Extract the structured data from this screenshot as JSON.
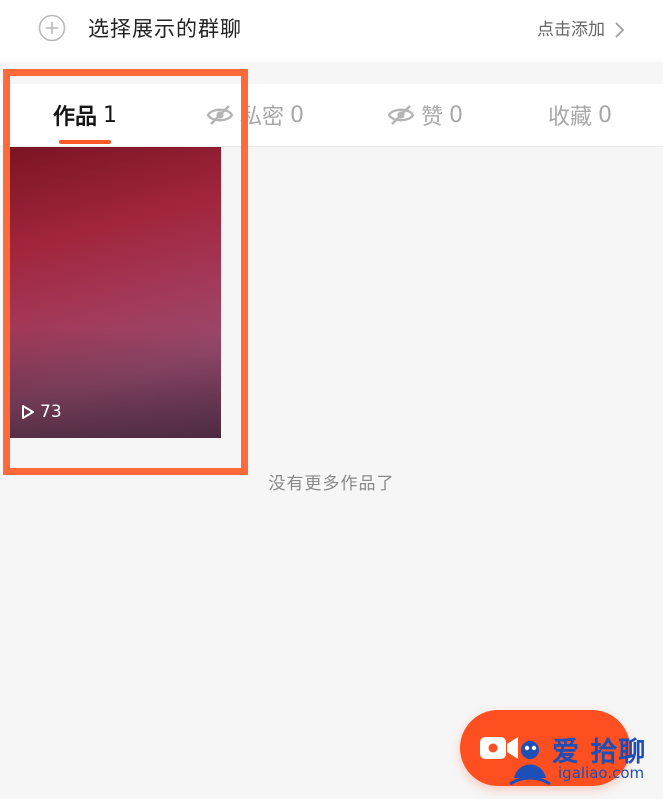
{
  "group_bar": {
    "title": "选择展示的群聊",
    "add_label": "点击添加"
  },
  "tabs": [
    {
      "label": "作品",
      "count": "1",
      "active": true
    },
    {
      "label": "私密",
      "count": "0",
      "active": false
    },
    {
      "label": "赞",
      "count": "0",
      "active": false
    },
    {
      "label": "收藏",
      "count": "0",
      "active": false
    }
  ],
  "video": {
    "play_count": "73"
  },
  "empty_hint": "没有更多作品了",
  "watermark": {
    "main": "爱 拾聊",
    "sub": "igaliao.com"
  },
  "colors": {
    "accent": "#fe4f20",
    "tab_underline": "#fe5a28",
    "highlight": "#ff6a3a",
    "watermark": "#1d4fb8"
  },
  "icons": {
    "group_add": "plus-circle-icon",
    "add_chevron": "chevron-right-icon",
    "private_tab": "eye-off-icon",
    "like_tab": "eye-off-icon",
    "play": "play-icon",
    "record": "camera-icon"
  }
}
